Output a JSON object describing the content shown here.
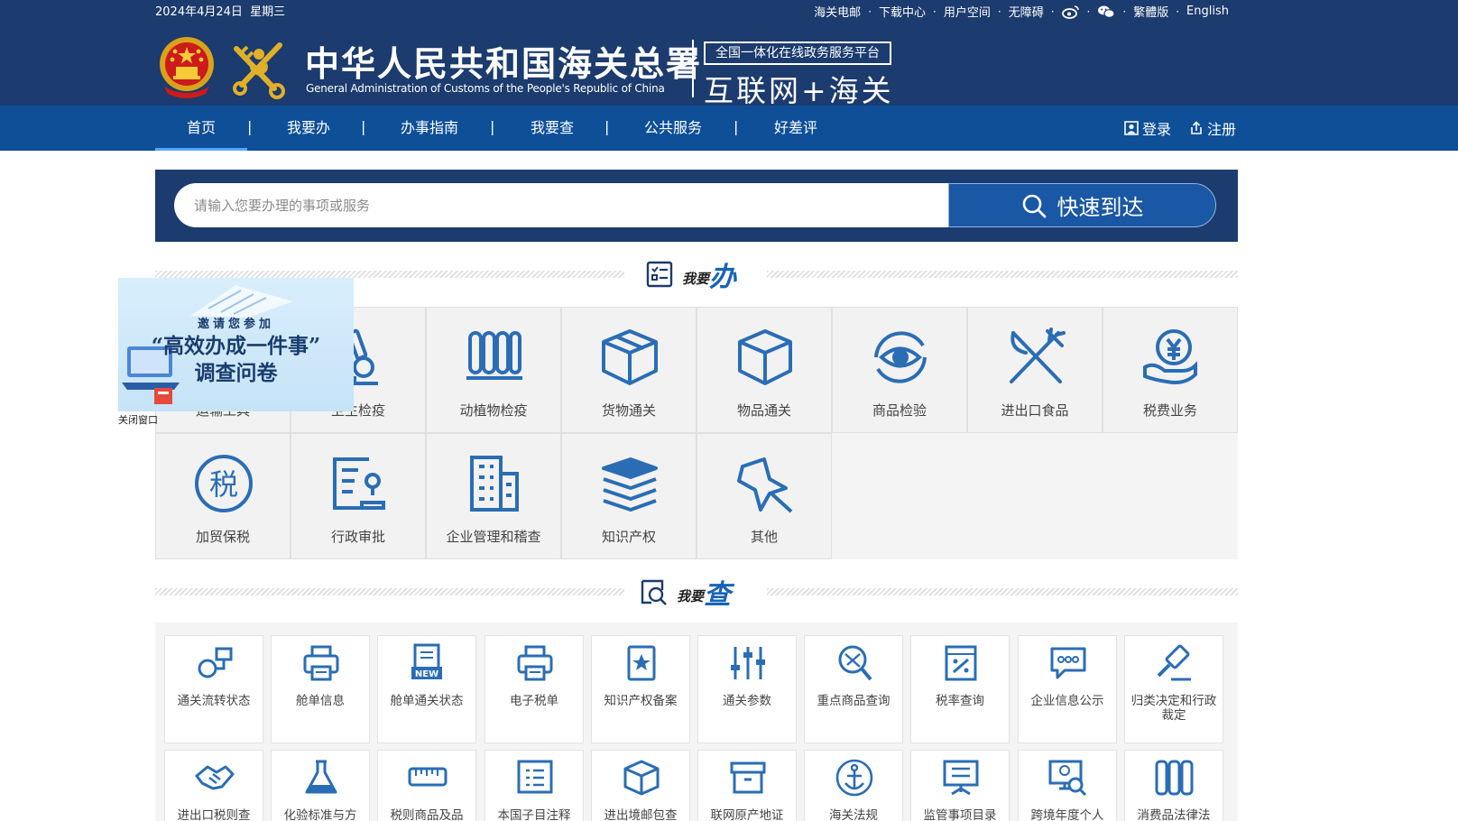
{
  "header": {
    "date": "2024年4月24日",
    "weekday": "星期三",
    "top_links": [
      "海关电邮",
      "下载中心",
      "用户空间",
      "无障碍"
    ],
    "weibo_icon": "weibo-icon",
    "wechat_icon": "wechat-icon",
    "traditional": "繁體版",
    "english": "English",
    "title_cn": "中华人民共和国海关总署",
    "title_en": "General Administration of Customs of the People's Republic of China",
    "platform": "全国一体化在线政务服务平台",
    "platform_sub": "互联网+海关"
  },
  "nav": {
    "items": [
      "首页",
      "我要办",
      "办事指南",
      "我要查",
      "公共服务",
      "好差评"
    ],
    "active": "首页",
    "login": "登录",
    "register": "注册"
  },
  "search": {
    "placeholder": "请输入您要办理的事项或服务",
    "button": "快速到达"
  },
  "section_do": {
    "label_small": "我要",
    "label_big": "办"
  },
  "section_query": {
    "label_small": "我要",
    "label_big": "查"
  },
  "services": [
    {
      "label": "运输工具",
      "icon": "vehicle-icon"
    },
    {
      "label": "卫生检疫",
      "icon": "microscope-icon"
    },
    {
      "label": "动植物检疫",
      "icon": "quarantine-icon"
    },
    {
      "label": "货物通关",
      "icon": "cargo-box-icon"
    },
    {
      "label": "物品通关",
      "icon": "package-icon"
    },
    {
      "label": "商品检验",
      "icon": "eye-inspection-icon"
    },
    {
      "label": "进出口食品",
      "icon": "fork-knife-icon"
    },
    {
      "label": "税费业务",
      "icon": "yuan-hand-icon"
    },
    {
      "label": "加贸保税",
      "icon": "tax-icon"
    },
    {
      "label": "行政审批",
      "icon": "approval-icon"
    },
    {
      "label": "企业管理和稽查",
      "icon": "building-icon"
    },
    {
      "label": "知识产权",
      "icon": "books-icon"
    },
    {
      "label": "其他",
      "icon": "pin-icon"
    }
  ],
  "popup": {
    "invite": "邀请您参加",
    "quote": "“高效办成一件事”",
    "survey": "调查问卷",
    "close": "关闭窗口"
  },
  "queries": [
    {
      "label": "通关流转状态",
      "icon": "globe-flow-icon"
    },
    {
      "label": "舱单信息",
      "icon": "printer-icon"
    },
    {
      "label": "舱单通关状态",
      "icon": "new-doc-icon"
    },
    {
      "label": "电子税单",
      "icon": "printer-icon"
    },
    {
      "label": "知识产权备案",
      "icon": "star-book-icon"
    },
    {
      "label": "通关参数",
      "icon": "sliders-icon"
    },
    {
      "label": "重点商品查询",
      "icon": "magnifier-tools-icon"
    },
    {
      "label": "税率查询",
      "icon": "rate-doc-icon"
    },
    {
      "label": "企业信息公示",
      "icon": "chat-bubble-icon"
    },
    {
      "label": "归类决定和行政裁定",
      "icon": "gavel-icon"
    },
    {
      "label": "进出口税则查",
      "icon": "handshake-icon"
    },
    {
      "label": "化验标准与方",
      "icon": "flask-icon"
    },
    {
      "label": "税则商品及品",
      "icon": "ruler-icon"
    },
    {
      "label": "本国子目注释",
      "icon": "list-doc-icon"
    },
    {
      "label": "进出境邮包查",
      "icon": "parcel-icon"
    },
    {
      "label": "联网原产地证",
      "icon": "archive-box-icon"
    },
    {
      "label": "海关法规",
      "icon": "anchor-icon"
    },
    {
      "label": "监管事项目录",
      "icon": "board-icon"
    },
    {
      "label": "跨境年度个人",
      "icon": "monitor-search-icon"
    },
    {
      "label": "消费品法律法",
      "icon": "columns-icon"
    }
  ],
  "colors": {
    "header_bg": "#1c3b6e",
    "nav_bg": "#0e4f98",
    "icon_blue": "#2a6db5",
    "button_blue": "#1a57a5"
  }
}
